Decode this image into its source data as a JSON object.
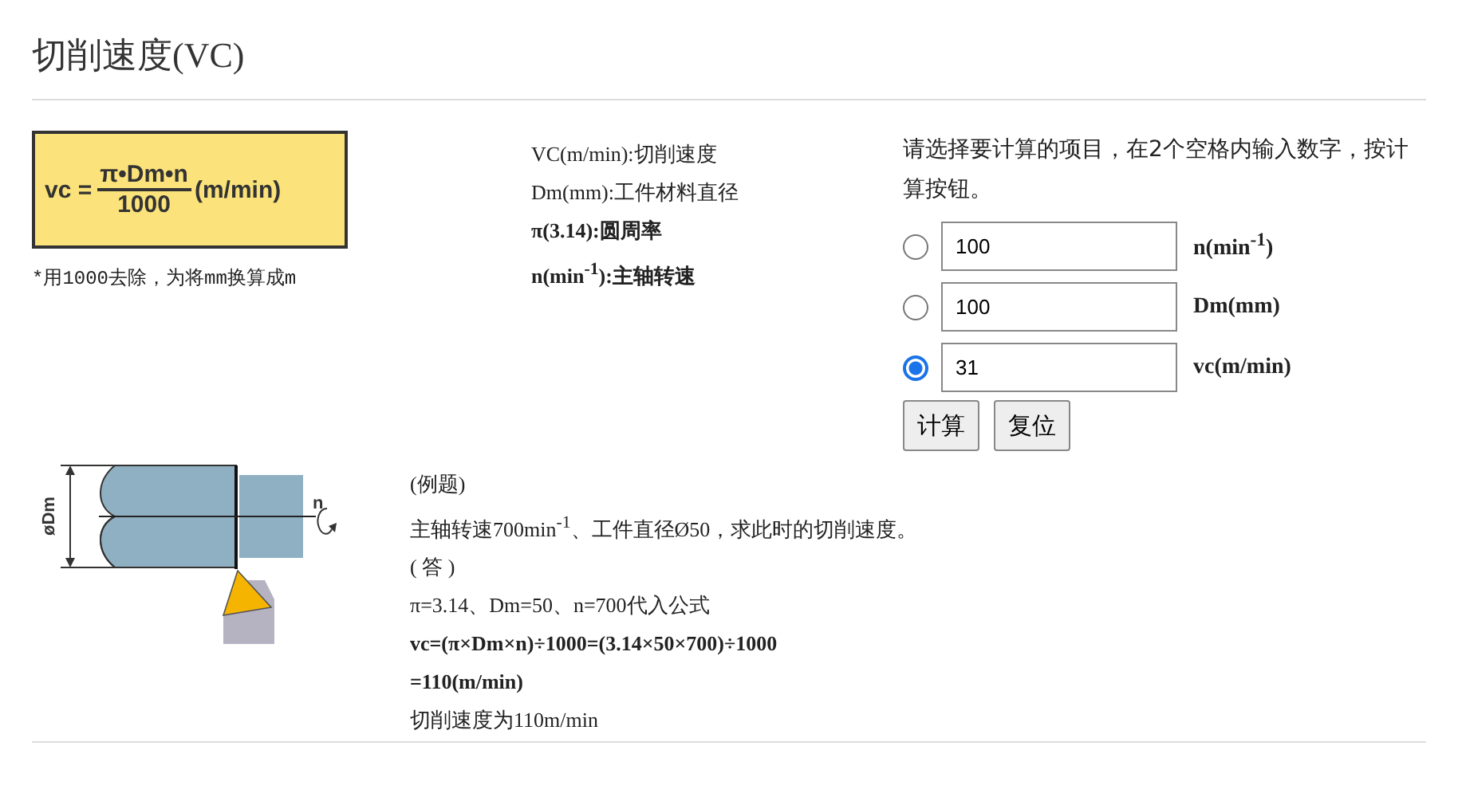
{
  "page": {
    "title": "切削速度(VC)"
  },
  "formula": {
    "lhs": "vc =",
    "numerator": "π•Dm•n",
    "denominator": "1000",
    "unit": "(m/min)",
    "note": "*用1000去除，为将mm换算成m"
  },
  "definitions": [
    {
      "text": "VC(m/min):切削速度",
      "bold": false
    },
    {
      "text": "Dm(mm):工件材料直径",
      "bold": false
    },
    {
      "text": "π(3.14):圆周率",
      "bold": true
    },
    {
      "text": "n(min$^{-1}$):主轴转速",
      "bold": true
    }
  ],
  "calculator": {
    "instruction": "请选择要计算的项目，在2个空格内输入数字，按计算按钮。",
    "rows": [
      {
        "selected": false,
        "value": "100",
        "label": "n(min$^{-1}$)"
      },
      {
        "selected": false,
        "value": "100",
        "label": "Dm(mm)"
      },
      {
        "selected": true,
        "value": "31",
        "label": "vc(m/min)"
      }
    ],
    "buttons": [
      "计算",
      "复位"
    ]
  },
  "diagram": {
    "diameter_label": "øDm",
    "rotation_label": "n"
  },
  "example": [
    {
      "text": "(例题)",
      "bold": false
    },
    {
      "text": "主轴转速700min$^{-1}$、工件直径Ø50，求此时的切削速度。",
      "bold": false
    },
    {
      "text": "( 答 )",
      "bold": false
    },
    {
      "text": "π=3.14、Dm=50、n=700代入公式",
      "bold": false
    },
    {
      "text": "vc=(π×Dm×n)÷1000=(3.14×50×700)÷1000",
      "bold": true
    },
    {
      "text": "=110(m/min)",
      "bold": true
    },
    {
      "text": "切削速度为110m/min",
      "bold": false
    }
  ]
}
